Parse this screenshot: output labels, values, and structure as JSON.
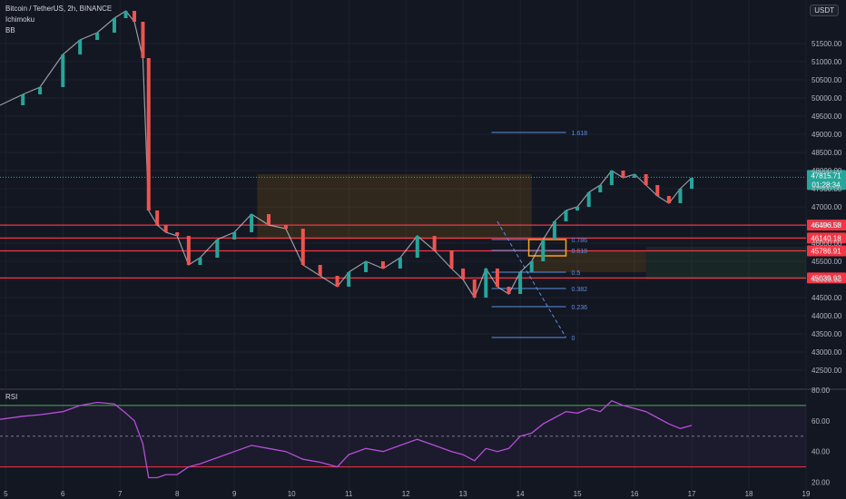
{
  "header": {
    "symbol": "Bitcoin / TetherUS, 2h, BINANCE",
    "indicator1": "Ichimoku",
    "indicator2": "BB",
    "currency": "USDT"
  },
  "rsi_label": "RSI",
  "colors": {
    "background": "#131722",
    "grid": "#1e222d",
    "up": "#26a69a",
    "down": "#ef5350",
    "level_line": "#f23645",
    "fib_line": "#5b8fe0",
    "rsi_line": "#b54fd8",
    "rsi_band_upper": "#4caf50",
    "rsi_band_lower": "#f23645",
    "kumo": "#ff9800",
    "orange_box": "#f5a623",
    "current_price": "#26a69a",
    "ichimoku_line": "#4caf50",
    "bb_basis": "#ff6d00"
  },
  "chart_data": [
    {
      "type": "line",
      "panel": "price",
      "ylim": [
        42000,
        52700
      ],
      "y_ticks": [
        42500,
        43000,
        43500,
        44000,
        44500,
        45000,
        45500,
        46000,
        46500,
        47000,
        47500,
        48000,
        48500,
        49000,
        49500,
        50000,
        50500,
        51000,
        51500
      ],
      "x_ticks": [
        "5",
        "6",
        "7",
        "8",
        "9",
        "10",
        "11",
        "12",
        "13",
        "14",
        "15",
        "16",
        "17",
        "18",
        "19"
      ],
      "xlim": [
        4.9,
        19.0
      ],
      "price_series": {
        "x": [
          4.9,
          5.3,
          5.6,
          6.0,
          6.3,
          6.6,
          6.9,
          7.1,
          7.25,
          7.4,
          7.5,
          7.65,
          7.8,
          8.0,
          8.2,
          8.4,
          8.7,
          9.0,
          9.3,
          9.6,
          9.9,
          10.2,
          10.5,
          10.8,
          11.0,
          11.3,
          11.6,
          11.9,
          12.2,
          12.5,
          12.8,
          13.0,
          13.2,
          13.4,
          13.6,
          13.8,
          14.0,
          14.2,
          14.4,
          14.6,
          14.8,
          15.0,
          15.2,
          15.4,
          15.6,
          15.8,
          16.0,
          16.2,
          16.4,
          16.6,
          16.8,
          17.0
        ],
        "close": [
          49800,
          50100,
          50300,
          51200,
          51600,
          51800,
          52200,
          52400,
          52100,
          51100,
          46900,
          46500,
          46300,
          46200,
          45400,
          45600,
          46100,
          46300,
          46800,
          46500,
          46400,
          45400,
          45100,
          44800,
          45200,
          45500,
          45300,
          45600,
          46200,
          45800,
          45300,
          45000,
          44500,
          45300,
          44800,
          44600,
          45200,
          45500,
          46100,
          46600,
          46900,
          47000,
          47400,
          47600,
          48000,
          47800,
          47900,
          47600,
          47300,
          47100,
          47500,
          47800
        ]
      },
      "horizontal_levels": [
        {
          "price": 46496.58,
          "label": "46496.58"
        },
        {
          "price": 46140.18,
          "label": "46140.18"
        },
        {
          "price": 45786.91,
          "label": "45786.91"
        },
        {
          "price": 45039.92,
          "label": "45039.92"
        }
      ],
      "current_price": {
        "price": 47815.71,
        "label": "47815.71",
        "countdown": "01:28:34"
      },
      "fibonacci": [
        {
          "level": "1.618",
          "price": 49050
        },
        {
          "level": "0.786",
          "price": 46100
        },
        {
          "level": "0.618",
          "price": 45800
        },
        {
          "level": "0.5",
          "price": 45200
        },
        {
          "level": "0.382",
          "price": 44750
        },
        {
          "level": "0.236",
          "price": 44250
        },
        {
          "level": "0",
          "price": 43400
        }
      ]
    },
    {
      "type": "line",
      "panel": "rsi",
      "title": "RSI",
      "ylim": [
        15,
        80
      ],
      "y_ticks": [
        20,
        40,
        60,
        80
      ],
      "y_tick_labels": [
        "20.00",
        "40.00",
        "60.00",
        "80.00"
      ],
      "bands": [
        30,
        50,
        70
      ],
      "x": [
        4.9,
        5.3,
        5.6,
        6.0,
        6.3,
        6.6,
        6.9,
        7.1,
        7.25,
        7.4,
        7.5,
        7.65,
        7.8,
        8.0,
        8.2,
        8.4,
        8.7,
        9.0,
        9.3,
        9.6,
        9.9,
        10.2,
        10.5,
        10.8,
        11.0,
        11.3,
        11.6,
        11.9,
        12.2,
        12.5,
        12.8,
        13.0,
        13.2,
        13.4,
        13.6,
        13.8,
        14.0,
        14.2,
        14.4,
        14.6,
        14.8,
        15.0,
        15.2,
        15.4,
        15.6,
        15.8,
        16.0,
        16.2,
        16.4,
        16.6,
        16.8,
        17.0
      ],
      "values": [
        61,
        63,
        64,
        66,
        70,
        72,
        71,
        65,
        60,
        45,
        23,
        23,
        25,
        25,
        30,
        32,
        36,
        40,
        44,
        42,
        40,
        35,
        33,
        30,
        38,
        42,
        40,
        44,
        48,
        44,
        40,
        38,
        34,
        42,
        40,
        42,
        50,
        52,
        58,
        62,
        66,
        65,
        68,
        66,
        73,
        70,
        68,
        66,
        62,
        58,
        55,
        57
      ]
    }
  ]
}
